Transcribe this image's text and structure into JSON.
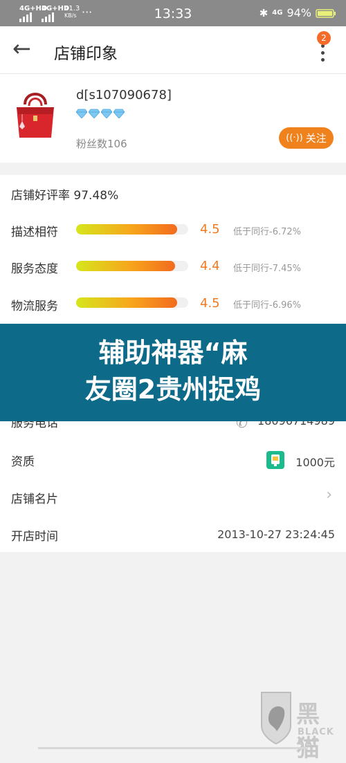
{
  "status_bar": {
    "network1": "4G+HD",
    "network2": "4G+HD",
    "speed": "41.3",
    "speed_unit": "KB/s",
    "more": "···",
    "time": "13:33",
    "network3": "4G",
    "battery": "94%"
  },
  "header": {
    "title": "店铺印象",
    "badge": "2"
  },
  "store": {
    "name": "d[s107090678]",
    "diamond_count": 4,
    "fans": "粉丝数106",
    "follow_label": "关注"
  },
  "ratings": {
    "title": "店铺好评率 97.48%",
    "rows": [
      {
        "label": "描述相符",
        "score": "4.5",
        "fill": 0.9,
        "compare": "低于同行-6.72%"
      },
      {
        "label": "服务态度",
        "score": "4.4",
        "fill": 0.88,
        "compare": "低于同行-7.45%"
      },
      {
        "label": "物流服务",
        "score": "4.5",
        "fill": 0.9,
        "compare": "低于同行-6.96%"
      }
    ]
  },
  "overlay": {
    "line1": "辅助神器“麻",
    "line2": "友圈2贵州捉鸡"
  },
  "info": {
    "phone_label": "服务电话",
    "phone_value": "18096714989",
    "qual_label": "资质",
    "qual_value": "1000元",
    "card_label": "店铺名片",
    "open_label": "开店时间",
    "open_value": "2013-10-27 23:24:45"
  },
  "watermark": {
    "cn": "黑猫",
    "en": "BLACK CAT"
  },
  "colors": {
    "accent": "#f0821e",
    "overlay": "#0d6a88",
    "diamond": "#7ec8f2"
  }
}
